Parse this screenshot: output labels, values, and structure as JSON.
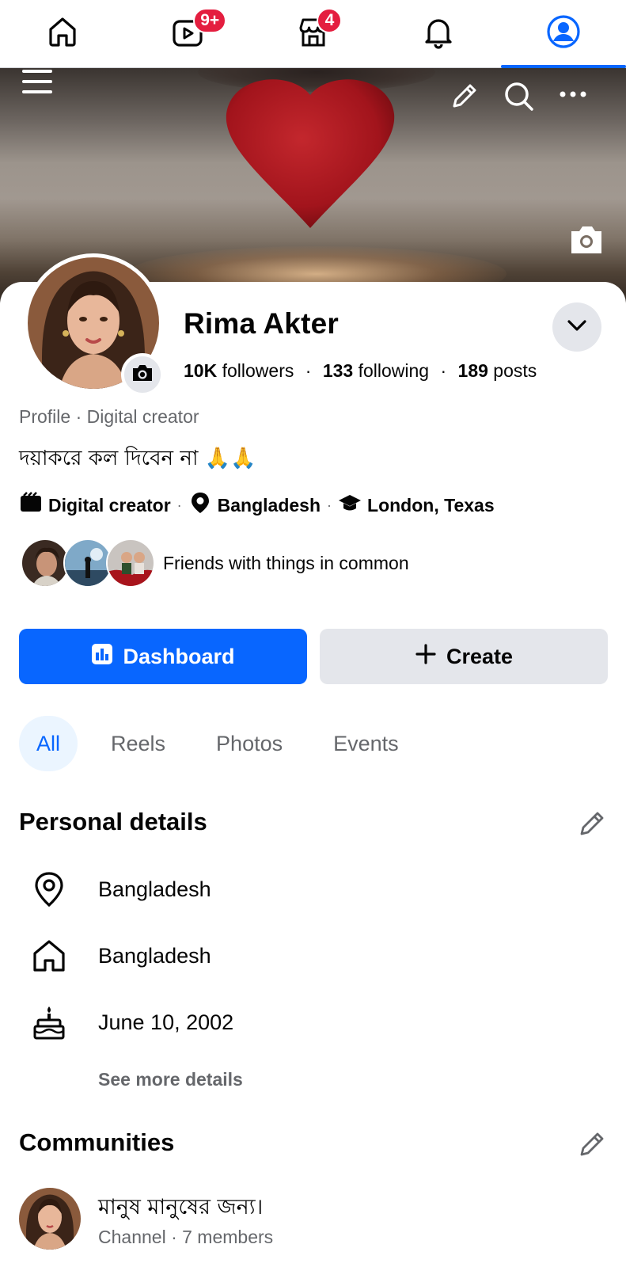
{
  "nav": {
    "items": [
      {
        "name": "home",
        "badge": ""
      },
      {
        "name": "video",
        "badge": "9+"
      },
      {
        "name": "marketplace",
        "badge": "4"
      },
      {
        "name": "notifications",
        "badge": ""
      },
      {
        "name": "profile",
        "badge": "",
        "active": true
      }
    ]
  },
  "cover": {
    "icons": [
      "menu-icon",
      "pencil-icon",
      "search-icon",
      "more-icon",
      "camera-icon"
    ]
  },
  "profile": {
    "name": "Rima Akter",
    "followers_count": "10K",
    "followers_label": "followers",
    "following_count": "133",
    "following_label": "following",
    "posts_count": "189",
    "posts_label": "posts",
    "separator": "·",
    "subtitle": "Profile · Digital creator",
    "bio": "দয়াকরে কল দিবেন না 🙏🙏",
    "facts": [
      {
        "icon": "clapperboard-icon",
        "label": "Digital creator"
      },
      {
        "icon": "location-pin-icon",
        "label": "Bangladesh"
      },
      {
        "icon": "graduation-cap-icon",
        "label": "London, Texas"
      }
    ],
    "friends_text": "Friends with things in common"
  },
  "actions": {
    "dashboard_label": "Dashboard",
    "create_label": "Create"
  },
  "tabs": [
    {
      "label": "All",
      "active": true
    },
    {
      "label": "Reels"
    },
    {
      "label": "Photos"
    },
    {
      "label": "Events"
    }
  ],
  "personal_details": {
    "title": "Personal details",
    "rows": [
      {
        "icon": "location-pin-icon",
        "text": "Bangladesh"
      },
      {
        "icon": "home-icon",
        "text": "Bangladesh"
      },
      {
        "icon": "birthday-cake-icon",
        "text": "June 10, 2002"
      }
    ],
    "see_more": "See more details"
  },
  "communities": {
    "title": "Communities",
    "items": [
      {
        "name": "মানুষ মানুষের জন্য।",
        "meta": "Channel · 7 members"
      }
    ]
  },
  "colors": {
    "accent": "#0866ff",
    "badge": "#e41e3f",
    "secondary_text": "#65676b",
    "light_gray": "#e4e6eb"
  }
}
